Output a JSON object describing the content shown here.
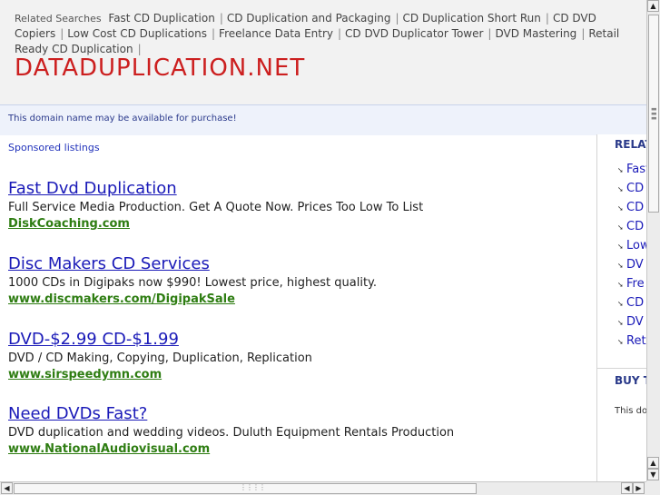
{
  "header": {
    "related_label": "Related Searches",
    "related_links": [
      "Fast CD Duplication",
      "CD Duplication and Packaging",
      "CD Duplication Short Run",
      "CD DVD Copiers",
      "Low Cost CD Duplications",
      "Freelance Data Entry",
      "CD DVD Duplicator Tower",
      "DVD Mastering",
      "Retail Ready CD Duplication"
    ],
    "separator": "|",
    "site_title": "DATADUPLICATION.NET"
  },
  "domain_notice": "This domain name may be available for purchase!",
  "sponsored_label": "Sponsored listings",
  "listings": [
    {
      "title": "Fast Dvd Duplication",
      "desc": "Full Service Media Production. Get A Quote Now. Prices Too Low To List",
      "url": "DiskCoaching.com"
    },
    {
      "title": "Disc Makers CD Services",
      "desc": "1000 CDs in Digipaks now $990! Lowest price, highest quality.",
      "url": "www.discmakers.com/DigipakSale"
    },
    {
      "title": "DVD-$2.99 CD-$1.99",
      "desc": "DVD / CD Making, Copying, Duplication, Replication",
      "url": "www.sirspeedymn.com"
    },
    {
      "title": "Need DVDs Fast?",
      "desc": "DVD duplication and wedding videos. Duluth Equipment Rentals Production",
      "url": "www.NationalAudiovisual.com"
    }
  ],
  "right_column": {
    "related_heading": "RELATED",
    "related_items": [
      "Fast",
      "CD",
      "CD",
      "CD",
      "Low",
      "DV",
      "Fre",
      "CD",
      "DV",
      "Ret"
    ],
    "buy_heading": "BUY T",
    "buy_text": "This dom"
  },
  "scrollbars": {
    "arrow_up": "▲",
    "arrow_down": "▼",
    "arrow_left": "◀",
    "arrow_right": "▶"
  }
}
